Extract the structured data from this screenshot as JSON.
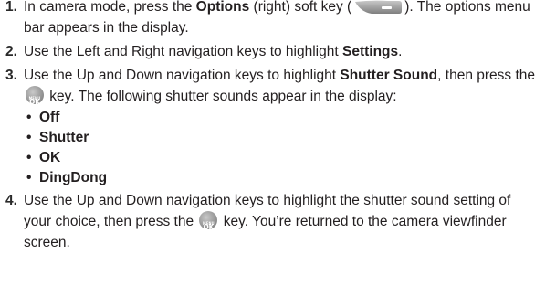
{
  "steps": [
    {
      "number": "1.",
      "parts": {
        "a": "In camera mode, press the ",
        "b_options": "Options",
        "c": " (right) soft key (",
        "d": "). The options menu bar appears in the display."
      }
    },
    {
      "number": "2.",
      "parts": {
        "a": "Use the Left and Right navigation keys to highlight ",
        "b_settings": "Settings",
        "c": "."
      }
    },
    {
      "number": "3.",
      "parts": {
        "a": "Use the Up and Down navigation keys to highlight ",
        "b_shutter": "Shutter Sound",
        "c": ", then press the ",
        "d": " key. The following shutter sounds appear in the display:"
      },
      "options": [
        "Off",
        "Shutter",
        "OK",
        "DingDong"
      ]
    },
    {
      "number": "4.",
      "parts": {
        "a": "Use the Up and Down navigation keys to highlight the shutter sound setting of your choice, then press the ",
        "b": " key. You’re returned to the camera viewfinder screen."
      }
    }
  ],
  "icons": {
    "soft_key": "right-soft-key-icon",
    "ok_key": "menu-ok-key-icon",
    "ok_key_text_top": "MENU",
    "ok_key_text_bottom": "OK"
  },
  "bullet_char": "•"
}
